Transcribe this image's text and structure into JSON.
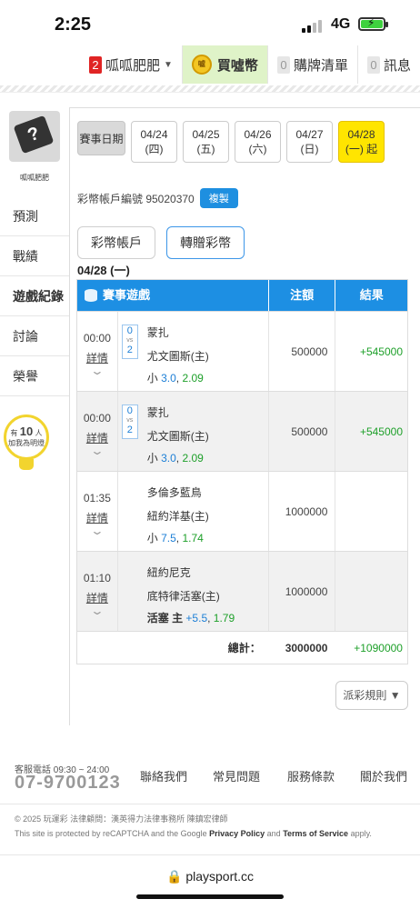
{
  "status_bar": {
    "time": "2:25",
    "network": "4G"
  },
  "topnav": {
    "user": {
      "count": "2",
      "name": "呱呱肥肥"
    },
    "coin": {
      "label": "買噓幣",
      "coin_text": "噓"
    },
    "cart": {
      "count": "0",
      "label": "購牌清單"
    },
    "messages": {
      "count": "0",
      "label": "訊息"
    }
  },
  "sidebar": {
    "username": "呱呱肥肥",
    "items": [
      {
        "label": "預測"
      },
      {
        "label": "戰績"
      },
      {
        "label": "遊戲紀錄"
      },
      {
        "label": "討論"
      },
      {
        "label": "榮譽"
      }
    ],
    "bulb": {
      "prefix": "有",
      "count": "10",
      "suffix": "人",
      "line2": "加我為明燈"
    }
  },
  "main": {
    "date_label": "賽事日期",
    "dates": [
      {
        "date": "04/24",
        "day": "(四)"
      },
      {
        "date": "04/25",
        "day": "(五)"
      },
      {
        "date": "04/26",
        "day": "(六)"
      },
      {
        "date": "04/27",
        "day": "(日)"
      },
      {
        "date": "04/28",
        "day": "(一) 起"
      }
    ],
    "account_label": "彩幣帳戶編號 95020370",
    "copy_label": "複製",
    "tabs": [
      {
        "label": "彩幣帳戶"
      },
      {
        "label": "轉贈彩幣"
      }
    ],
    "day_label": "04/28 (一)",
    "table": {
      "headers": {
        "game": "賽事遊戲",
        "amount": "注額",
        "result": "結果"
      },
      "detail_label": "詳情",
      "rows": [
        {
          "time": "00:00",
          "score_a": "0",
          "vs": "vs",
          "score_b": "2",
          "team1": "蒙扎",
          "team2": "尤文圖斯(主)",
          "pick_text": "小 ",
          "pick_num": "3.0",
          "pick_sep": ", ",
          "pick_odd": "2.09",
          "amount": "500000",
          "result": "+545000"
        },
        {
          "time": "00:00",
          "score_a": "0",
          "vs": "vs",
          "score_b": "2",
          "team1": "蒙扎",
          "team2": "尤文圖斯(主)",
          "pick_text": "小 ",
          "pick_num": "3.0",
          "pick_sep": ", ",
          "pick_odd": "2.09",
          "amount": "500000",
          "result": "+545000"
        },
        {
          "time": "01:35",
          "team1": "多倫多藍鳥",
          "team2": "紐約洋基(主)",
          "pick_text": "小 ",
          "pick_num": "7.5",
          "pick_sep": ", ",
          "pick_odd": "1.74",
          "amount": "1000000",
          "result": ""
        },
        {
          "time": "01:10",
          "team1": "紐約尼克",
          "team2": "底特律活塞(主)",
          "pick_text": "活塞 主 ",
          "pick_num": "+5.5",
          "pick_sep": ", ",
          "pick_odd": "1.79",
          "amount": "1000000",
          "result": ""
        }
      ],
      "total": {
        "label": "總計：",
        "amount": "3000000",
        "result": "+1090000"
      }
    },
    "rule_button": "派彩規則 ▼"
  },
  "footer": {
    "hotline_label": "客服電話 09:30 ~ 24:00",
    "hotline": "07-9700123",
    "links": [
      {
        "label": "聯絡我們"
      },
      {
        "label": "常見問題"
      },
      {
        "label": "服務條款"
      },
      {
        "label": "關於我們"
      }
    ],
    "copyright": "© 2025 玩運彩 法律顧問：漢英得力法律事務所 陳鎮宏律師",
    "recaptcha_pre": "This site is protected by reCAPTCHA and the Google ",
    "privacy": "Privacy Policy",
    "and": " and ",
    "terms": "Terms of Service",
    "apply": " apply.",
    "url": "playsport.cc"
  },
  "colors": {
    "accent_blue": "#1d8fe3",
    "win_green": "#1ea02a",
    "active_yellow": "#ffe500",
    "badge_red": "#e02424"
  }
}
